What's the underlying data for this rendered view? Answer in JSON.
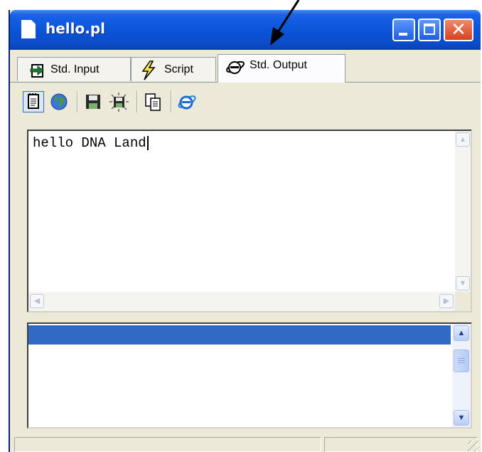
{
  "window": {
    "title": "hello.pl"
  },
  "tabs": [
    {
      "label": "Std. Input",
      "icon": "arrow-into-page-icon",
      "active": false
    },
    {
      "label": "Script",
      "icon": "lightning-icon",
      "active": false
    },
    {
      "label": "Std. Output",
      "icon": "internet-explorer-icon",
      "active": true
    }
  ],
  "toolbar": {
    "icons": [
      "notepad-icon",
      "globe-icon",
      "save-icon",
      "save-all-icon",
      "copy-icon",
      "internet-explorer-icon"
    ]
  },
  "output": {
    "text": "hello DNA Land"
  },
  "colors": {
    "titlebar": "#0a55d8",
    "selection": "#316ac5",
    "close_button": "#d8401c",
    "face": "#ece9d8"
  }
}
